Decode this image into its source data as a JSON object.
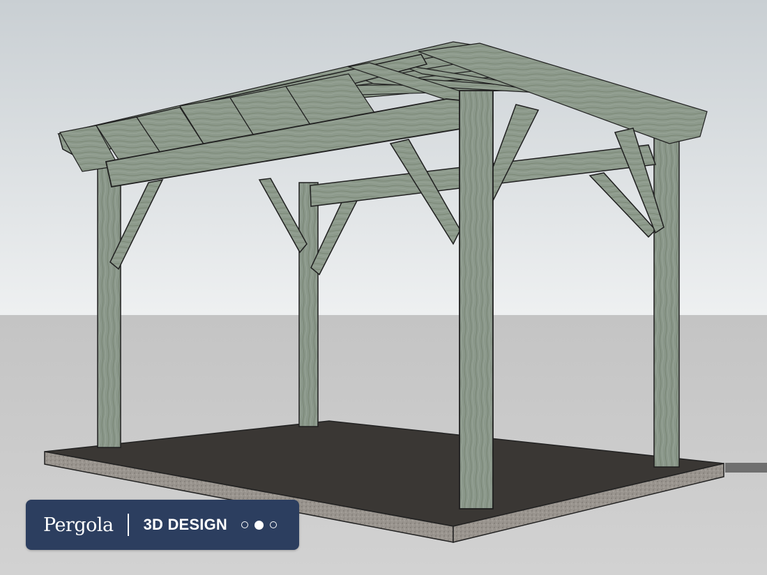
{
  "badge": {
    "brand": "Pergola",
    "label": "3D DESIGN",
    "carousel": {
      "total": 3,
      "active_index": 1
    }
  },
  "colors": {
    "badge_background": "#2c3e5f",
    "wood": "#8a978a",
    "slab_top": "#3a3734",
    "slab_edge": "#9b9691",
    "sky": "#d6d9db",
    "ground": "#c7c7c7"
  },
  "icons": {
    "carousel_dot": "circle"
  }
}
